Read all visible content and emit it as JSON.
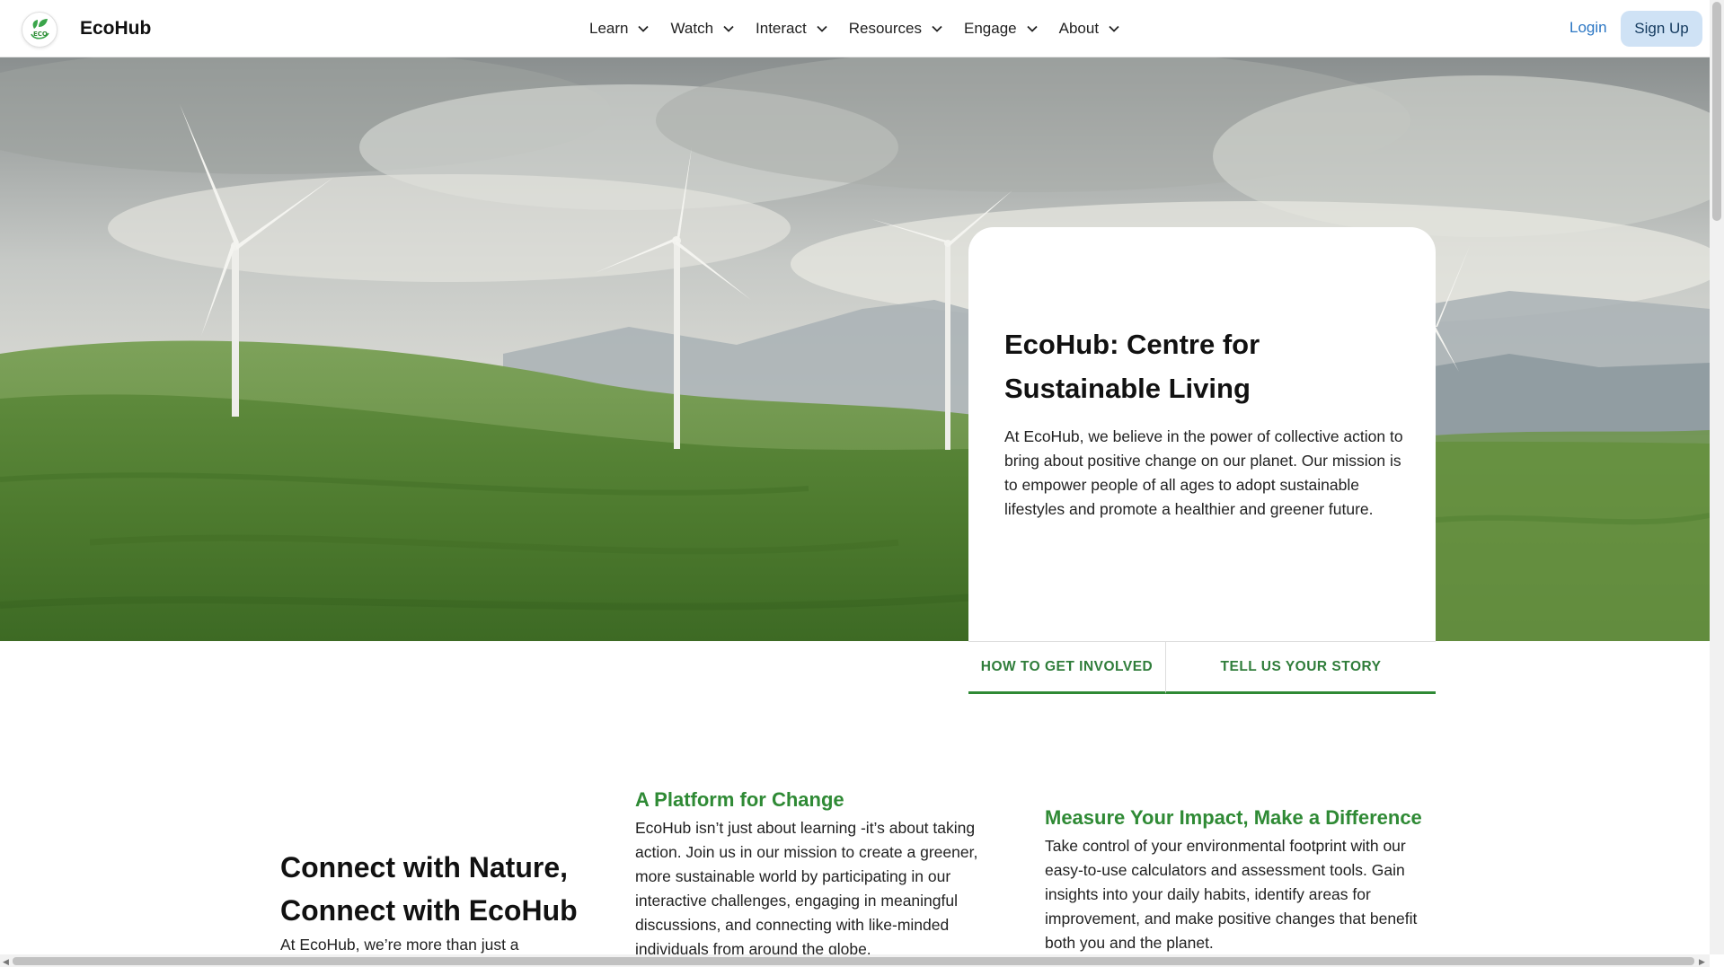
{
  "header": {
    "logo_text": "ECO",
    "brand": "EcoHub",
    "nav": [
      {
        "label": "Learn"
      },
      {
        "label": "Watch"
      },
      {
        "label": "Interact"
      },
      {
        "label": "Resources"
      },
      {
        "label": "Engage"
      },
      {
        "label": "About"
      }
    ],
    "login_label": "Login",
    "signup_label": "Sign Up"
  },
  "hero": {
    "title": "EcoHub: Centre for Sustainable Living",
    "text": "At EcoHub, we believe in the power of collective action to bring about positive change on our planet. Our mission is to empower people of all ages to adopt sustainable lifestyles and promote a healthier and greener future.",
    "tabs": [
      {
        "label": "HOW TO GET INVOLVED"
      },
      {
        "label": "TELL US YOUR STORY"
      }
    ]
  },
  "sections": {
    "left": {
      "heading": "Connect with Nature, Connect with EcoHub",
      "text": "At EcoHub, we’re more than just a"
    },
    "mid": {
      "heading": "A Platform for Change",
      "text": "EcoHub isn’t just about learning -it’s about taking action. Join us in our mission to create a greener, more sustainable world by participating in our interactive challenges, engaging in meaningful discussions, and connecting with like-minded individuals from around the globe."
    },
    "right": {
      "heading": "Measure Your Impact, Make a Difference",
      "text": "Take control of your environmental footprint with our easy-to-use calculators and assessment tools. Gain insights into your daily habits, identify areas for improvement, and make positive changes that benefit both you and the planet."
    }
  },
  "colors": {
    "accent_green": "#2f8a35",
    "link_blue": "#2c77c4",
    "signup_bg": "#cfe2f5"
  },
  "icons": {
    "logo": "eco-leaf-icon",
    "nav_chevron": "chevron-down-icon"
  }
}
